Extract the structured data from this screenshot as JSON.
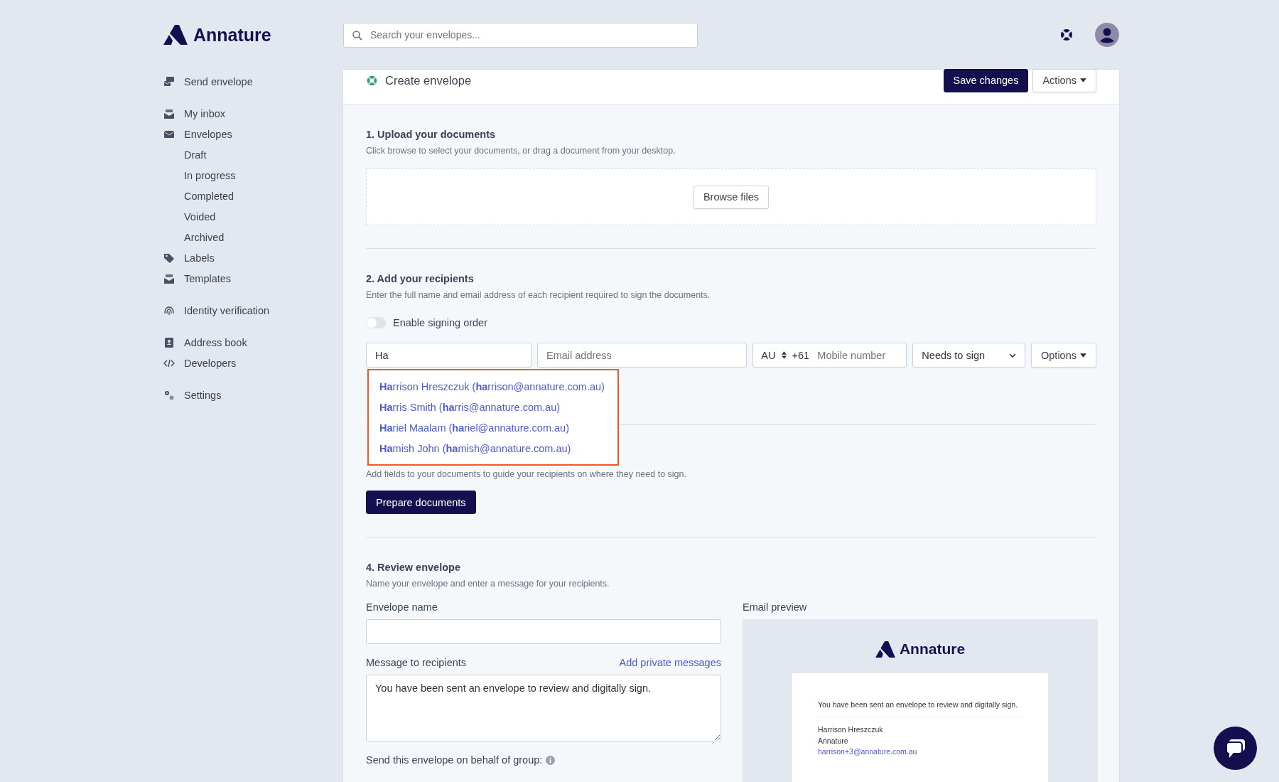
{
  "brand": {
    "name": "Annature"
  },
  "search": {
    "placeholder": "Search your envelopes..."
  },
  "sidebar": {
    "groups": [
      {
        "items": [
          {
            "label": "Send envelope",
            "kind": "send"
          }
        ]
      },
      {
        "items": [
          {
            "label": "My inbox",
            "kind": "inbox"
          },
          {
            "label": "Envelopes",
            "kind": "envelope",
            "children": [
              {
                "label": "Draft"
              },
              {
                "label": "In progress"
              },
              {
                "label": "Completed"
              },
              {
                "label": "Voided"
              },
              {
                "label": "Archived"
              }
            ]
          },
          {
            "label": "Labels",
            "kind": "label"
          },
          {
            "label": "Templates",
            "kind": "template"
          }
        ]
      },
      {
        "items": [
          {
            "label": "Identity verification",
            "kind": "identity"
          }
        ]
      },
      {
        "items": [
          {
            "label": "Address book",
            "kind": "book"
          },
          {
            "label": "Developers",
            "kind": "code"
          }
        ]
      },
      {
        "items": [
          {
            "label": "Settings",
            "kind": "settings"
          }
        ]
      }
    ]
  },
  "header": {
    "title": "Create envelope",
    "buttons": [
      {
        "label": "Save changes",
        "kind": "primary"
      },
      {
        "label": "Actions",
        "kind": "menu"
      }
    ]
  },
  "upload": {
    "title": "1. Upload your documents",
    "description": "Click browse to select your documents, or drag a document from your desktop.",
    "button": "Browse files"
  },
  "recipients": {
    "title": "2. Add your recipients",
    "description": "Enter the full name and email address of each recipient required to sign the documents.",
    "signing_order": {
      "label": "Enable signing order",
      "on": false
    },
    "name_value": "Ha",
    "email_placeholder": "Email address",
    "country": "AU",
    "dial_code": "+61",
    "mobile_placeholder": "Mobile number",
    "role": "Needs to sign",
    "options_button": "Options",
    "suggestions": [
      "**Ha**rrison Hreszczuk (**ha**rrison@annature.com.au)",
      "**Ha**rris Smith (**ha**rris@annature.com.au)",
      "**Ha**riel Maalam (**ha**riel@annature.com.au)",
      "**Ha**mish John (**ha**mish@annature.com.au)"
    ]
  },
  "prepare": {
    "description": "Add fields to your documents to guide your recipients on where they need to sign.",
    "button": "Prepare documents"
  },
  "review": {
    "title": "4. Review envelope",
    "description": "Name your envelope and enter a message for your recipients.",
    "envelope_name_label": "Envelope name",
    "message_label": "Message to recipients",
    "private_link": "Add private messages",
    "message_value": "You have been sent an envelope to review and digitally sign.",
    "group_label": "Send this envelope on behalf of group:",
    "preview": {
      "label": "Email preview",
      "brand": "Annature",
      "message": "You have been sent an envelope to review and digitally sign.",
      "sender_name": "Harrison Hreszczuk",
      "sender_company": "Annature",
      "sender_email": "harrison+3@annature.com.au"
    }
  }
}
